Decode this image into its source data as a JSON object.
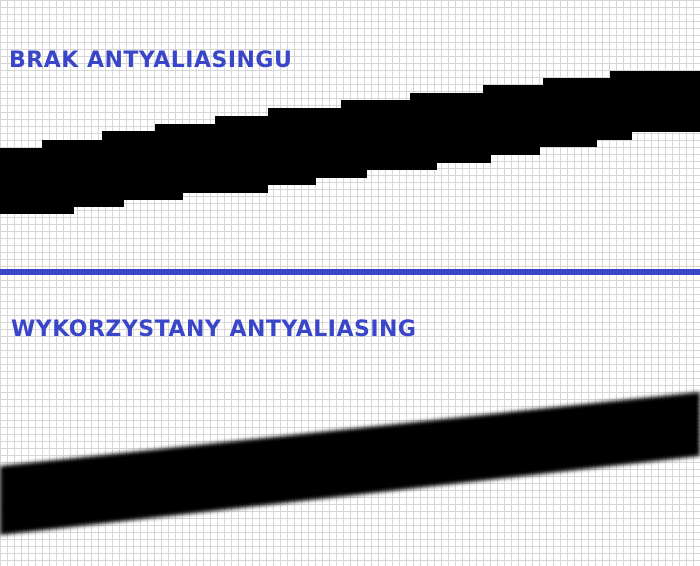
{
  "top_panel": {
    "heading": "BRAK ANTYALIASINGU"
  },
  "bottom_panel": {
    "heading": "WYKORZYSTANY ANTYALIASING"
  },
  "colors": {
    "heading": "#3a46c8",
    "divider": "#3a46c8",
    "stroke": "#000000",
    "grid": "#d6d6d6",
    "background": "#ffffff"
  }
}
